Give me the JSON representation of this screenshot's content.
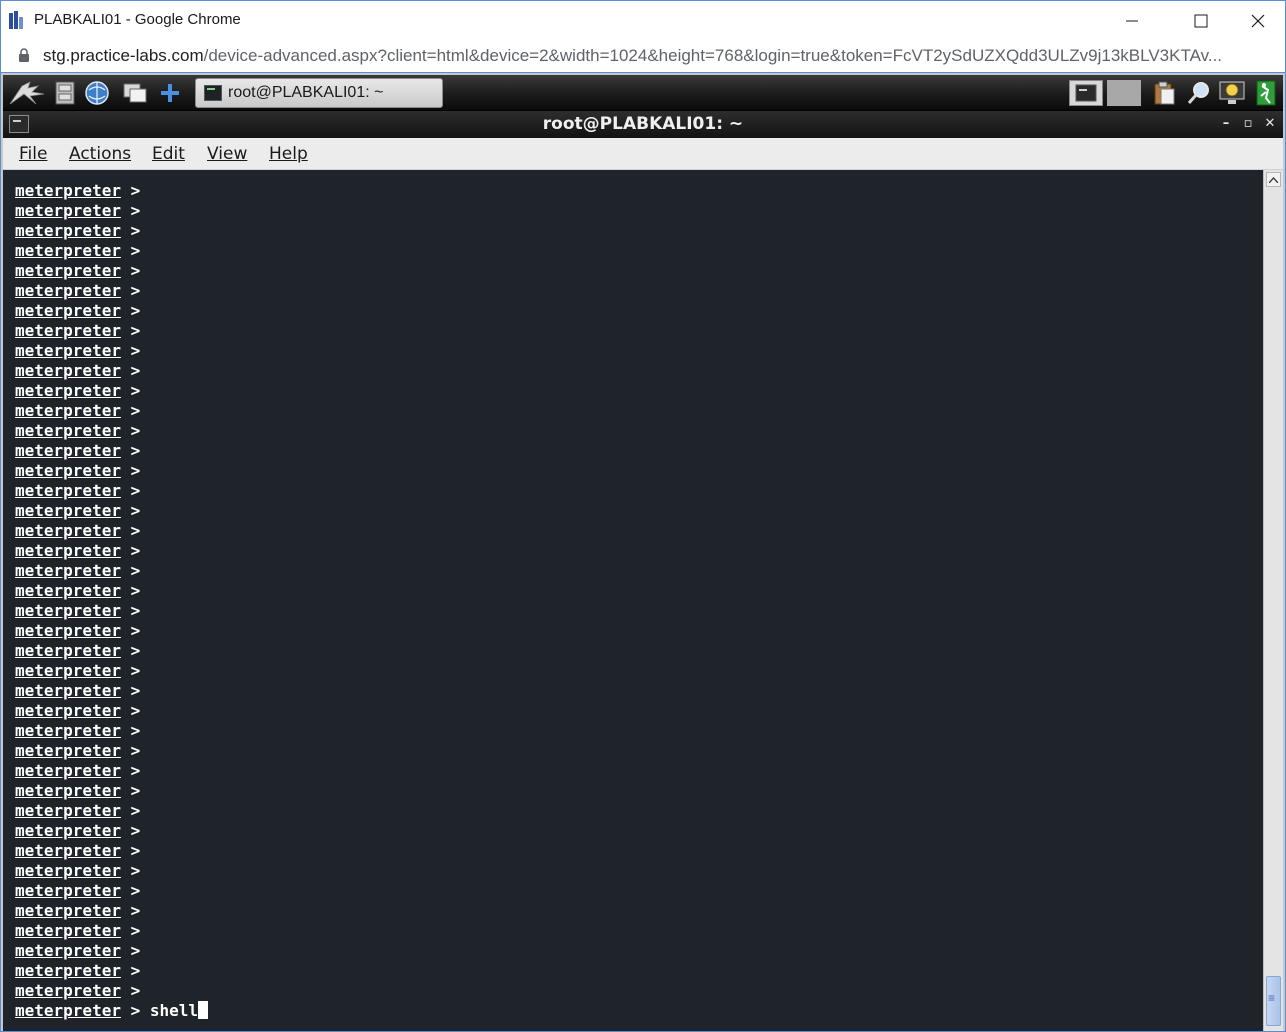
{
  "browser": {
    "window_title": "PLABKALI01 - Google Chrome",
    "url_host": "stg.practice-labs.com",
    "url_path": "/device-advanced.aspx?client=html&device=2&width=1024&height=768&login=true&token=FcVT2ySdUZXQdd3ULZv9j13kBLV3KTAv..."
  },
  "desktop": {
    "taskbar_window_label": "root@PLABKALI01: ~"
  },
  "terminal": {
    "window_title": "root@PLABKALI01: ~",
    "menu": {
      "file": "File",
      "actions": "Actions",
      "edit": "Edit",
      "view": "View",
      "help": "Help"
    },
    "prompt": "meterpreter",
    "prompt_symbol": ">",
    "empty_prompt_count": 41,
    "current_command": "shell"
  },
  "colors": {
    "terminal_bg": "#1f232a",
    "terminal_fg": "#ffffff",
    "panel_bg": "#1b1b1b"
  }
}
